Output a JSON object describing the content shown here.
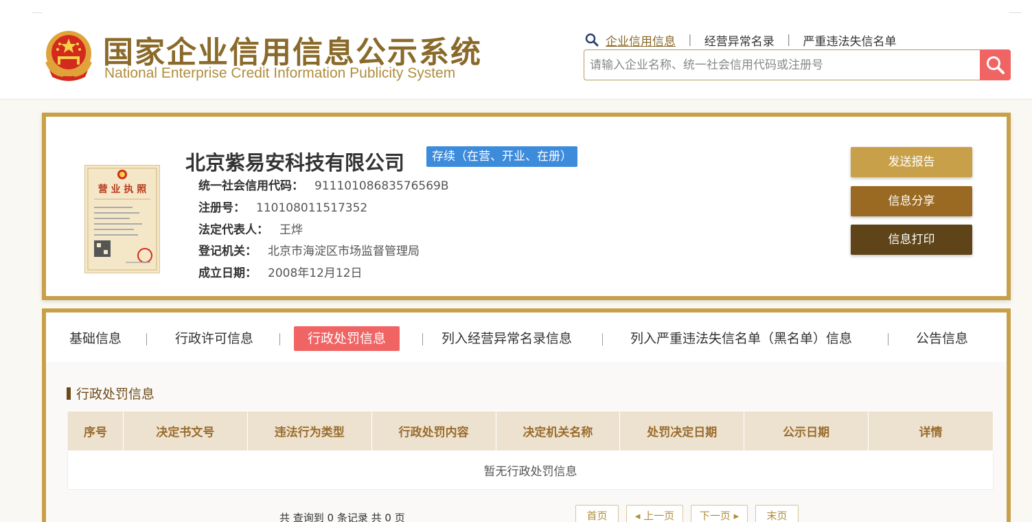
{
  "header": {
    "title": "国家企业信用信息公示系统",
    "subtitle": "National Enterprise Credit Information Publicity System",
    "links": [
      {
        "label": "企业信用信息"
      },
      {
        "label": "经营异常名录"
      },
      {
        "label": "严重违法失信名单"
      }
    ],
    "link_sep": "|",
    "search_placeholder": "请输入企业名称、统一社会信用代码或注册号"
  },
  "company": {
    "name": "北京紫易安科技有限公司",
    "status": "存续（在营、开业、在册）",
    "fields": [
      {
        "label": "统一社会信用代码：",
        "value": "91110108683576569B"
      },
      {
        "label": "注册号：",
        "value": "110108011517352"
      },
      {
        "label": "法定代表人：",
        "value": "王烨"
      },
      {
        "label": "登记机关：",
        "value": "北京市海淀区市场监督管理局"
      },
      {
        "label": "成立日期：",
        "value": "2008年12月12日"
      }
    ],
    "license_image_text": "营业执照"
  },
  "actions": {
    "send_report": "发送报告",
    "share": "信息分享",
    "print": "信息打印"
  },
  "tabs": [
    {
      "label": "基础信息"
    },
    {
      "label": "行政许可信息"
    },
    {
      "label": "行政处罚信息",
      "active": true
    },
    {
      "label": "列入经营异常名录信息"
    },
    {
      "label": "列入严重违法失信名单（黑名单）信息"
    },
    {
      "label": "公告信息"
    }
  ],
  "section": {
    "title": "行政处罚信息",
    "columns": [
      "序号",
      "决定书文号",
      "违法行为类型",
      "行政处罚内容",
      "决定机关名称",
      "处罚决定日期",
      "公示日期",
      "详情"
    ],
    "empty_text": "暂无行政处罚信息"
  },
  "pager": {
    "info": "共 查询到 0 条记录 共 0 页",
    "first": "首页",
    "prev": "上一页",
    "next": "下一页",
    "last": "末页"
  },
  "colors": {
    "gold_border": "#c9a04a",
    "accent_red": "#f06464",
    "status_blue": "#3d8bdb",
    "btn_send": "#c9a04a",
    "btn_share": "#9a6a22",
    "btn_print": "#5e4418"
  }
}
